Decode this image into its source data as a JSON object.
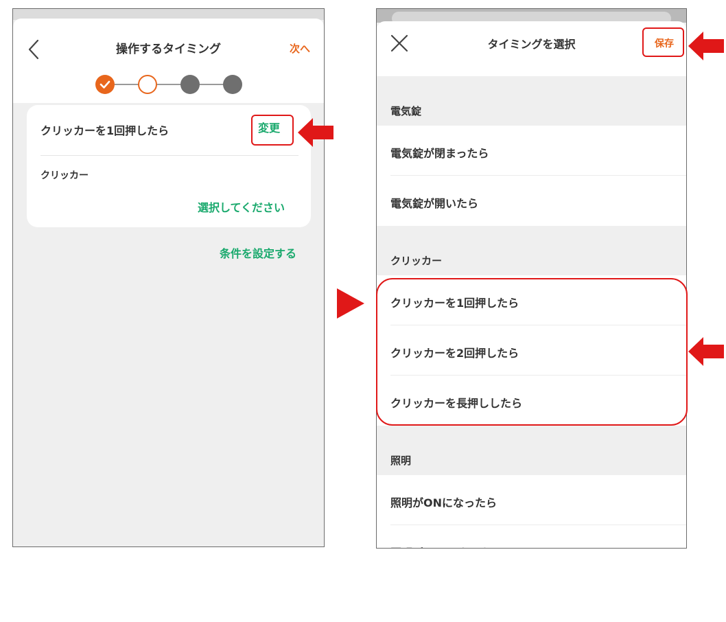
{
  "left_screen": {
    "title": "操作するタイミング",
    "next_label": "次へ",
    "stepper": [
      "done",
      "current",
      "todo",
      "todo"
    ],
    "trigger_label": "クリッカーを1回押したら",
    "change_label": "変更",
    "device_label": "クリッカー",
    "select_prompt": "選択してください",
    "condition_link": "条件を設定する"
  },
  "right_screen": {
    "title": "タイミングを選択",
    "save_label": "保存",
    "sections": [
      {
        "header": "電気錠",
        "items": [
          "電気錠が閉まったら",
          "電気錠が開いたら"
        ]
      },
      {
        "header": "クリッカー",
        "items": [
          "クリッカーを1回押したら",
          "クリッカーを2回押したら",
          "クリッカーを長押ししたら"
        ]
      },
      {
        "header": "照明",
        "items": [
          "照明がONになったら",
          "照明がOFFになったら"
        ]
      }
    ]
  },
  "colors": {
    "accent_orange": "#e8661c",
    "accent_green": "#1aa96d",
    "annotation_red": "#e01818"
  },
  "icons": [
    "chevron-left-icon",
    "check-icon",
    "close-icon",
    "red-arrow-icon",
    "play-triangle-icon"
  ]
}
